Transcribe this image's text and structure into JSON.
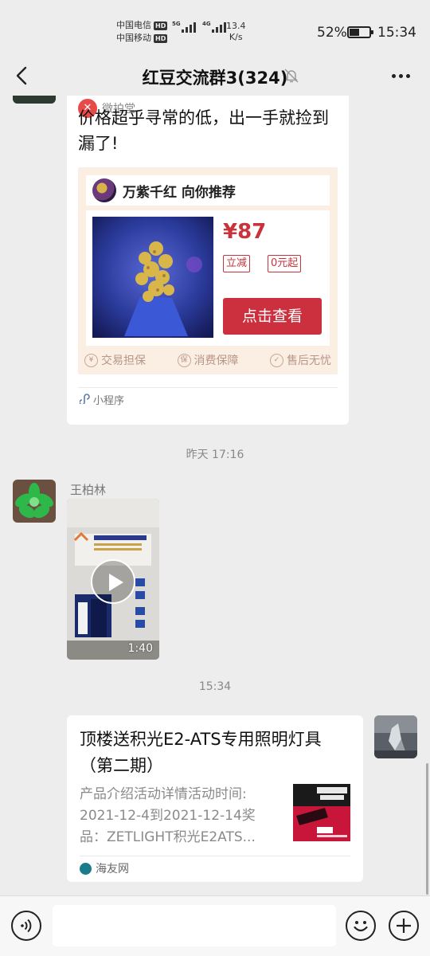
{
  "status_bar": {
    "carrier_1": "中国电信",
    "carrier_2": "中国移动",
    "hd_badge": "HD",
    "net_type_1": "5G",
    "net_type_2": "4G",
    "net_speed_value": "13.4",
    "net_speed_unit": "K/s",
    "battery_percent": "52%",
    "battery_level": 0.52,
    "time": "15:34"
  },
  "title_bar": {
    "title": "红豆交流群3(324)",
    "icons": [
      "back-arrow-icon",
      "mute-bell-icon",
      "more-icon"
    ]
  },
  "messages": {
    "mini_program": {
      "source_name": "微拍堂",
      "title": "价格超乎寻常的低，出一手就捡到漏了!",
      "seller_line": "万紫千红 向你推荐",
      "price": "¥87",
      "tag_1": "立减",
      "tag_2": "0元起",
      "cta": "点击查看",
      "guarantee_1": "交易担保",
      "guarantee_2": "消费保障",
      "guarantee_3": "售后无忧",
      "footer": "小程序"
    },
    "time_1": "昨天 17:16",
    "video": {
      "sender": "王柏林",
      "duration": "1:40"
    },
    "time_2": "15:34",
    "article": {
      "title": "顶楼送积光E2-ATS专用照明灯具（第二期）",
      "description": "产品介绍活动详情活动时间: 2021-12-4到2021-12-14奖品：ZETLIGHT积光E2ATS...",
      "source": "海友网"
    }
  },
  "input_bar": {
    "placeholder": "",
    "icons": [
      "voice-icon",
      "emoji-icon",
      "plus-icon"
    ]
  },
  "colors": {
    "background": "#ededed",
    "price_red": "#c9333b",
    "cta_red": "#cc2f3d",
    "bubble": "#ffffff"
  }
}
